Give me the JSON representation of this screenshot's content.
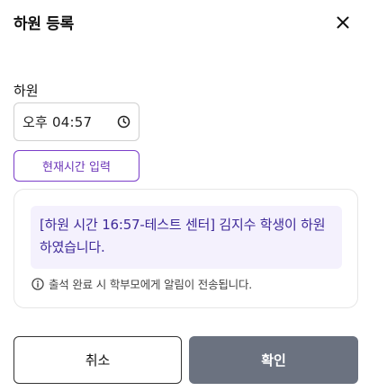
{
  "dialog": {
    "title": "하원 등록"
  },
  "form": {
    "label": "하원",
    "time_value": "오후 04:57",
    "now_button": "현재시간 입력"
  },
  "notice": {
    "message": "[하원 시간 16:57-테스트 센터] 김지수 학생이 하원하였습니다.",
    "info": "출석 완료 시 학부모에게 알림이 전송됩니다."
  },
  "actions": {
    "cancel": "취소",
    "confirm": "확인"
  },
  "colors": {
    "accent": "#6b33b8",
    "message_bg": "#f4f1fd",
    "message_text": "#3f2a99",
    "confirm_bg": "#6b7280"
  },
  "icons": {
    "close": "close-icon",
    "clock": "clock-icon",
    "info": "info-icon"
  }
}
